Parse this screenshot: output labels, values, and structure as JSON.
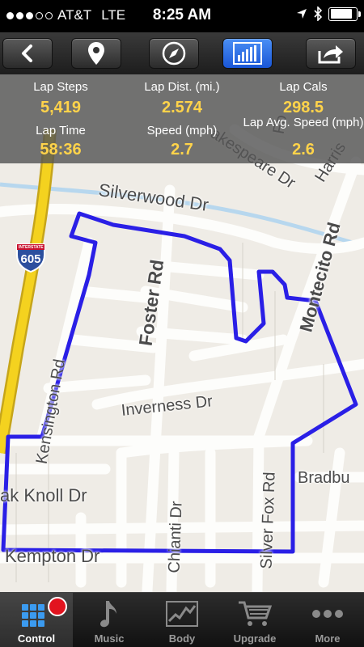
{
  "status_bar": {
    "carrier": "AT&T",
    "network": "LTE",
    "time": "8:25 AM",
    "signal_bars": 3
  },
  "toolbar": {
    "buttons": [
      {
        "icon": "back-chevron-icon"
      },
      {
        "icon": "location-pin-icon"
      },
      {
        "icon": "compass-icon"
      },
      {
        "icon": "bar-chart-icon",
        "active": true
      },
      {
        "icon": "share-icon"
      }
    ],
    "active_color": "#2a6fe8"
  },
  "stats": {
    "lap_steps": {
      "label": "Lap Steps",
      "value": "5,419"
    },
    "lap_distance": {
      "label": "Lap Dist. (mi.)",
      "value": "2.574"
    },
    "lap_cals": {
      "label": "Lap Cals",
      "value": "298.5"
    },
    "lap_time": {
      "label": "Lap Time",
      "value": "58:36"
    },
    "speed": {
      "label": "Speed (mph)",
      "value": "2.7"
    },
    "lap_avg_speed": {
      "label": "Lap Avg. Speed (mph)",
      "value": "2.6"
    },
    "value_color": "#ffd34a"
  },
  "map": {
    "streets": {
      "silverwood": "Silverwood Dr",
      "montecito": "Montecito Rd",
      "foster": "Foster Rd",
      "kensington": "Kensington Rd",
      "inverness": "Inverness Dr",
      "oak_knoll": "ak Knoll Dr",
      "kempton": "Kempton Dr",
      "chianti": "Chianti Dr",
      "silver_fox": "Silver Fox Rd",
      "bradbu": "Bradbu",
      "shakespeare": "akespeare Dr",
      "harris": "Harris",
      "fo": "Fo"
    },
    "highway_shield": "605",
    "highway_shield_top": "INTERSTATE",
    "route_color": "#2a1fe6"
  },
  "tab_bar": {
    "tabs": [
      {
        "label": "Control",
        "icon": "grid-control-icon",
        "active": true
      },
      {
        "label": "Music",
        "icon": "music-note-icon"
      },
      {
        "label": "Body",
        "icon": "body-chart-icon"
      },
      {
        "label": "Upgrade",
        "icon": "shopping-cart-icon"
      },
      {
        "label": "More",
        "icon": "more-dots-icon"
      }
    ]
  }
}
